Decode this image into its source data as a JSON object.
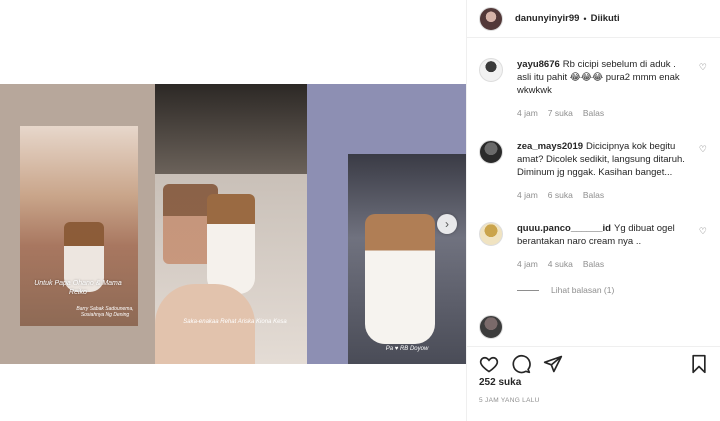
{
  "post": {
    "username": "danunyinyir99",
    "separator": "•",
    "follow_status": "Diikuti",
    "images": {
      "panel1_caption": "Untuk Papa Ohano & Mama Reiko",
      "panel1_small": "Barry Sabak Sadounema, Sosiahnya Ng Dening",
      "panel2_caption": "Saka-enakaa Rehat Ariska Kiona Kesa",
      "panel3_caption": "Pa ♥ RB Doyow"
    }
  },
  "comments": [
    {
      "username": "yayu8676",
      "text": "Rb cicipi sebelum di aduk . asli itu pahit 😂😂😂 pura2 mmm enak wkwkwk",
      "time": "4 jam",
      "likes": "7 suka",
      "reply": "Balas"
    },
    {
      "username": "zea_mays2019",
      "text": "Dicicipnya kok begitu amat? Dicolek sedikit, langsung ditaruh. Diminum jg nggak. Kasihan banget...",
      "time": "4 jam",
      "likes": "6 suka",
      "reply": "Balas"
    },
    {
      "username": "quuu.panco______id",
      "text": "Yg dibuat ogel berantakan naro cream nya ..",
      "time": "4 jam",
      "likes": "4 suka",
      "reply": "Balas",
      "view_replies": "Lihat balasan (1)"
    },
    {
      "username": "",
      "text": "",
      "time": "",
      "likes": "",
      "reply": ""
    }
  ],
  "footer": {
    "likes": "252 suka",
    "timestamp": "5 JAM YANG LALU"
  },
  "icons": {
    "heart": "heart-icon",
    "comment": "comment-icon",
    "share": "share-icon",
    "bookmark": "bookmark-icon",
    "next": "chevron-right-icon"
  }
}
